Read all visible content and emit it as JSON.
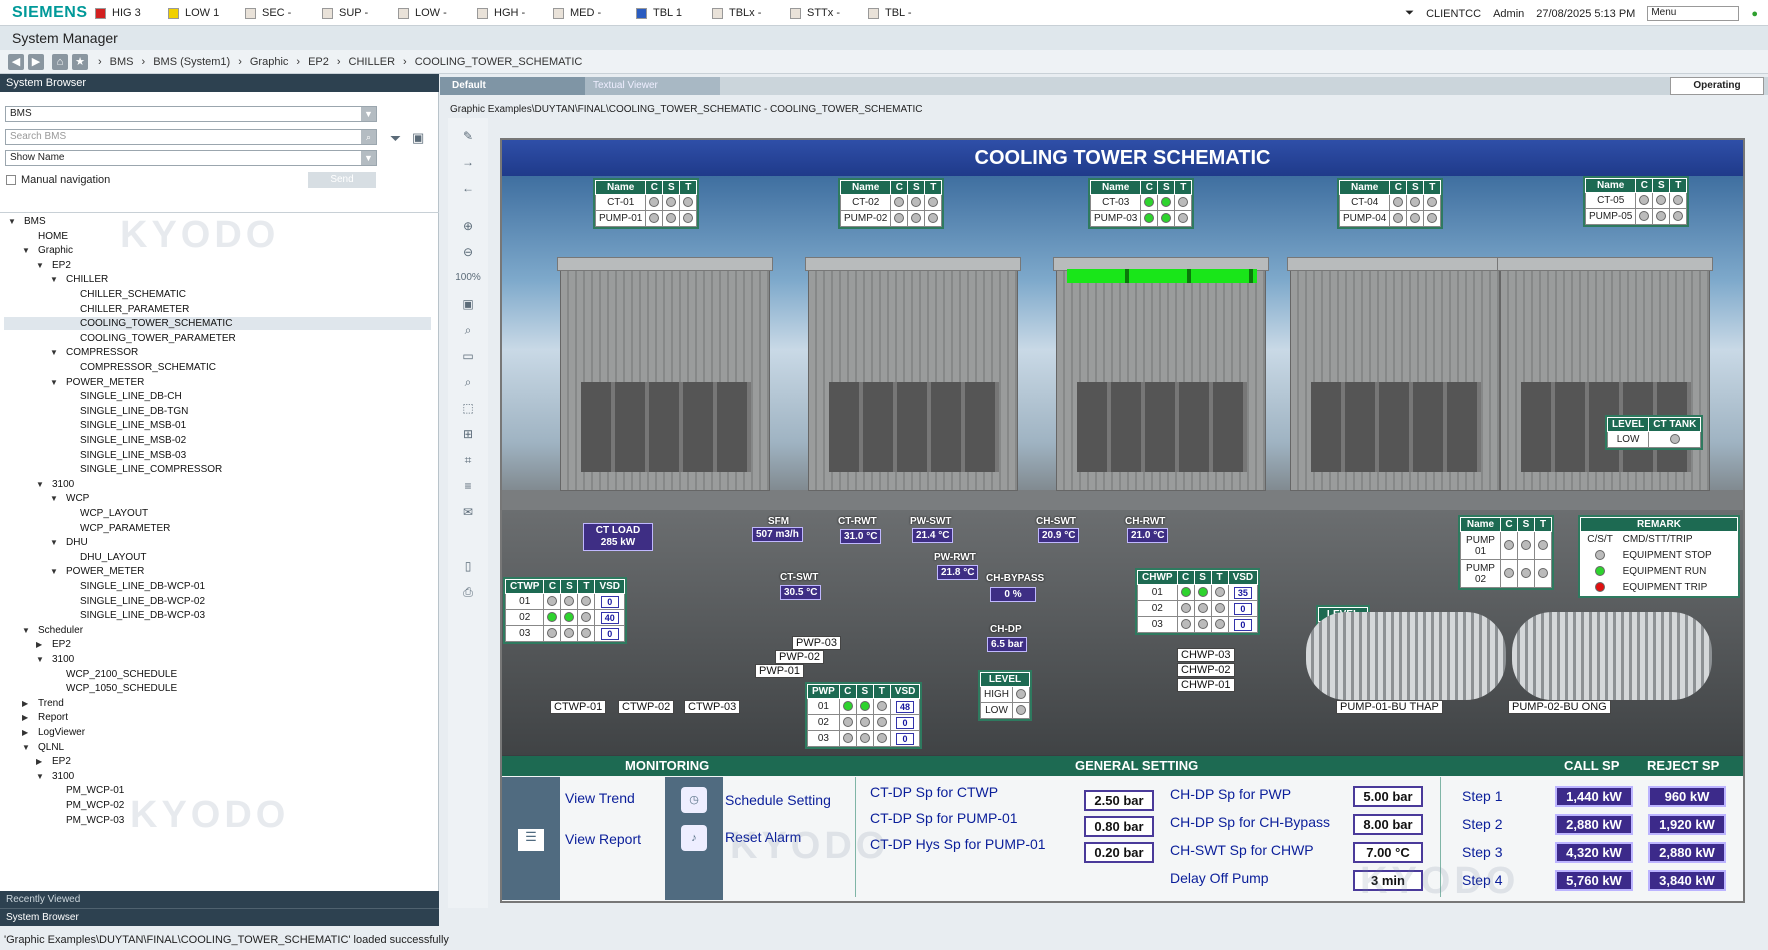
{
  "topbar": {
    "brand": "SIEMENS",
    "alarms": [
      {
        "label": "HIG 3",
        "color": "#d22020"
      },
      {
        "label": "LOW 1",
        "color": "#f0d000"
      },
      {
        "label": "SEC -",
        "color": "#e9e2d9"
      },
      {
        "label": "SUP -",
        "color": "#e9e2d9"
      },
      {
        "label": "LOW -",
        "color": "#e9e2d9"
      },
      {
        "label": "HGH -",
        "color": "#e9e2d9"
      },
      {
        "label": "MED -",
        "color": "#e9e2d9"
      },
      {
        "label": "TBL 1",
        "color": "#2a5cc0"
      },
      {
        "label": "TBLx -",
        "color": "#e9e2d9"
      },
      {
        "label": "STTx -",
        "color": "#e9e2d9"
      },
      {
        "label": "TBL -",
        "color": "#e9e2d9"
      }
    ],
    "client": "CLIENTCC",
    "user": "Admin",
    "datetime": "27/08/2025 5:13 PM",
    "menu": "Menu"
  },
  "app": {
    "title": "System Manager"
  },
  "breadcrumb": [
    "BMS",
    "BMS (System1)",
    "Graphic",
    "EP2",
    "CHILLER",
    "COOLING_TOWER_SCHEMATIC"
  ],
  "browser": {
    "header": "System Browser",
    "view_select": "BMS",
    "search_placeholder": "Search BMS",
    "name_select": "Show Name",
    "manual_nav": "Manual navigation",
    "send": "Send",
    "recently_viewed": "Recently Viewed",
    "footer": "System Browser"
  },
  "tree": [
    {
      "t": "BMS",
      "d": 0,
      "tw": "▼"
    },
    {
      "t": "HOME",
      "d": 1
    },
    {
      "t": "Graphic",
      "d": 1,
      "tw": "▼"
    },
    {
      "t": "EP2",
      "d": 2,
      "tw": "▼"
    },
    {
      "t": "CHILLER",
      "d": 3,
      "tw": "▼"
    },
    {
      "t": "CHILLER_SCHEMATIC",
      "d": 4
    },
    {
      "t": "CHILLER_PARAMETER",
      "d": 4
    },
    {
      "t": "COOLING_TOWER_SCHEMATIC",
      "d": 4,
      "sel": true
    },
    {
      "t": "COOLING_TOWER_PARAMETER",
      "d": 4
    },
    {
      "t": "COMPRESSOR",
      "d": 3,
      "tw": "▼"
    },
    {
      "t": "COMPRESSOR_SCHEMATIC",
      "d": 4
    },
    {
      "t": "POWER_METER",
      "d": 3,
      "tw": "▼"
    },
    {
      "t": "SINGLE_LINE_DB-CH",
      "d": 4
    },
    {
      "t": "SINGLE_LINE_DB-TGN",
      "d": 4
    },
    {
      "t": "SINGLE_LINE_MSB-01",
      "d": 4
    },
    {
      "t": "SINGLE_LINE_MSB-02",
      "d": 4
    },
    {
      "t": "SINGLE_LINE_MSB-03",
      "d": 4
    },
    {
      "t": "SINGLE_LINE_COMPRESSOR",
      "d": 4
    },
    {
      "t": "3100",
      "d": 2,
      "tw": "▼"
    },
    {
      "t": "WCP",
      "d": 3,
      "tw": "▼"
    },
    {
      "t": "WCP_LAYOUT",
      "d": 4
    },
    {
      "t": "WCP_PARAMETER",
      "d": 4
    },
    {
      "t": "DHU",
      "d": 3,
      "tw": "▼"
    },
    {
      "t": "DHU_LAYOUT",
      "d": 4
    },
    {
      "t": "POWER_METER",
      "d": 3,
      "tw": "▼"
    },
    {
      "t": "SINGLE_LINE_DB-WCP-01",
      "d": 4
    },
    {
      "t": "SINGLE_LINE_DB-WCP-02",
      "d": 4
    },
    {
      "t": "SINGLE_LINE_DB-WCP-03",
      "d": 4
    },
    {
      "t": "Scheduler",
      "d": 1,
      "tw": "▼"
    },
    {
      "t": "EP2",
      "d": 2,
      "tw": "▶"
    },
    {
      "t": "3100",
      "d": 2,
      "tw": "▼"
    },
    {
      "t": "WCP_2100_SCHEDULE",
      "d": 3
    },
    {
      "t": "WCP_1050_SCHEDULE",
      "d": 3
    },
    {
      "t": "Trend",
      "d": 1,
      "tw": "▶"
    },
    {
      "t": "Report",
      "d": 1,
      "tw": "▶"
    },
    {
      "t": "LogViewer",
      "d": 1,
      "tw": "▶"
    },
    {
      "t": "QLNL",
      "d": 1,
      "tw": "▼"
    },
    {
      "t": "EP2",
      "d": 2,
      "tw": "▶"
    },
    {
      "t": "3100",
      "d": 2,
      "tw": "▼"
    },
    {
      "t": "PM_WCP-01",
      "d": 3
    },
    {
      "t": "PM_WCP-02",
      "d": 3
    },
    {
      "t": "PM_WCP-03",
      "d": 3
    }
  ],
  "viewer": {
    "tab_default": "Default",
    "tab_textual": "Textual Viewer",
    "operating": "Operating",
    "path": "Graphic Examples\\DUYTAN\\FINAL\\COOLING_TOWER_SCHEMATIC  -  COOLING_TOWER_SCHEMATIC",
    "zoom": "100%"
  },
  "graphic": {
    "title": "COOLING TOWER SCHEMATIC",
    "ct_tables": [
      {
        "rows": [
          [
            "CT-01",
            0,
            0,
            0
          ],
          [
            "PUMP-01",
            0,
            0,
            0
          ]
        ]
      },
      {
        "rows": [
          [
            "CT-02",
            0,
            0,
            0
          ],
          [
            "PUMP-02",
            0,
            0,
            0
          ]
        ]
      },
      {
        "rows": [
          [
            "CT-03",
            1,
            1,
            0
          ],
          [
            "PUMP-03",
            1,
            1,
            0
          ]
        ]
      },
      {
        "rows": [
          [
            "CT-04",
            0,
            0,
            0
          ],
          [
            "PUMP-04",
            0,
            0,
            0
          ]
        ]
      },
      {
        "rows": [
          [
            "CT-05",
            0,
            0,
            0
          ],
          [
            "PUMP-05",
            0,
            0,
            0
          ]
        ]
      }
    ],
    "hdr": {
      "name": "Name",
      "c": "C",
      "s": "S",
      "t": "T",
      "vsd": "VSD",
      "level": "LEVEL",
      "high": "HIGH",
      "low": "LOW",
      "ct_tank": "CT TANK",
      "pump": "PUMP",
      "remark": "REMARK"
    },
    "level_ct": "LOW",
    "readings": {
      "ct_load_label": "CT LOAD",
      "ct_load": "285 kW",
      "sfm_label": "SFM",
      "sfm": "507 m3/h",
      "ct_rwt_label": "CT-RWT",
      "ct_rwt": "31.0 °C",
      "pw_swt_label": "PW-SWT",
      "pw_swt": "21.4 °C",
      "pw_rwt_label": "PW-RWT",
      "pw_rwt": "21.8 °C",
      "ct_swt_label": "CT-SWT",
      "ct_swt": "30.5 °C",
      "ch_swt_label": "CH-SWT",
      "ch_swt": "20.9 °C",
      "ch_rwt_label": "CH-RWT",
      "ch_rwt": "21.0 °C",
      "ch_bypass_label": "CH-BYPASS",
      "ch_bypass": "0 %",
      "ch_dp_label": "CH-DP",
      "ch_dp": "6.5 bar"
    },
    "ctwp": [
      [
        "01",
        0,
        0,
        0,
        "0"
      ],
      [
        "02",
        1,
        1,
        0,
        "40"
      ],
      [
        "03",
        0,
        0,
        0,
        "0"
      ]
    ],
    "pwp": [
      [
        "01",
        1,
        1,
        0,
        "48"
      ],
      [
        "02",
        0,
        0,
        0,
        "0"
      ],
      [
        "03",
        0,
        0,
        0,
        "0"
      ]
    ],
    "chwp": [
      [
        "01",
        1,
        1,
        0,
        "35"
      ],
      [
        "02",
        0,
        0,
        0,
        "0"
      ],
      [
        "03",
        0,
        0,
        0,
        "0"
      ]
    ],
    "pump_tbl": [
      [
        "PUMP 01",
        0,
        0,
        0
      ],
      [
        "PUMP 02",
        0,
        0,
        0
      ]
    ],
    "remark": {
      "header": "C/S/T",
      "header_text": "CMD/STT/TRIP",
      "stop": "EQUIPMENT STOP",
      "run": "EQUIPMENT RUN",
      "trip": "EQUIPMENT TRIP"
    },
    "ctwp_labels": [
      "CTWP-01",
      "CTWP-02",
      "CTWP-03"
    ],
    "pwp_labels": [
      "PWP-03",
      "PWP-02",
      "PWP-01"
    ],
    "chwp_labels": [
      "CHWP-03",
      "CHWP-02",
      "CHWP-01"
    ],
    "pump_labels": [
      "PUMP-01-BU THAP",
      "PUMP-02-BU ONG"
    ]
  },
  "bottom": {
    "monitoring": "MONITORING",
    "general": "GENERAL SETTING",
    "call_sp": "CALL SP",
    "reject_sp": "REJECT SP",
    "view_trend": "View Trend",
    "view_report": "View Report",
    "schedule": "Schedule Setting",
    "reset": "Reset Alarm",
    "settings_a": [
      {
        "label": "CT-DP Sp for CTWP",
        "value": "2.50 bar"
      },
      {
        "label": "CT-DP Sp for PUMP-01",
        "value": "0.80 bar"
      },
      {
        "label": "CT-DP Hys Sp for PUMP-01",
        "value": "0.20 bar"
      }
    ],
    "settings_b": [
      {
        "label": "CH-DP Sp for PWP",
        "value": "5.00 bar"
      },
      {
        "label": "CH-DP Sp for CH-Bypass",
        "value": "8.00 bar"
      },
      {
        "label": "CH-SWT Sp for CHWP",
        "value": "7.00 °C"
      },
      {
        "label": "Delay Off Pump",
        "value": "3 min"
      }
    ],
    "steps": [
      {
        "label": "Step 1",
        "call": "1,440 kW",
        "reject": "960 kW"
      },
      {
        "label": "Step 2",
        "call": "2,880 kW",
        "reject": "1,920 kW"
      },
      {
        "label": "Step 3",
        "call": "4,320 kW",
        "reject": "2,880 kW"
      },
      {
        "label": "Step 4",
        "call": "5,760 kW",
        "reject": "3,840 kW"
      }
    ]
  },
  "status": "'Graphic Examples\\DUYTAN\\FINAL\\COOLING_TOWER_SCHEMATIC' loaded successfully",
  "watermark": "KYODO"
}
